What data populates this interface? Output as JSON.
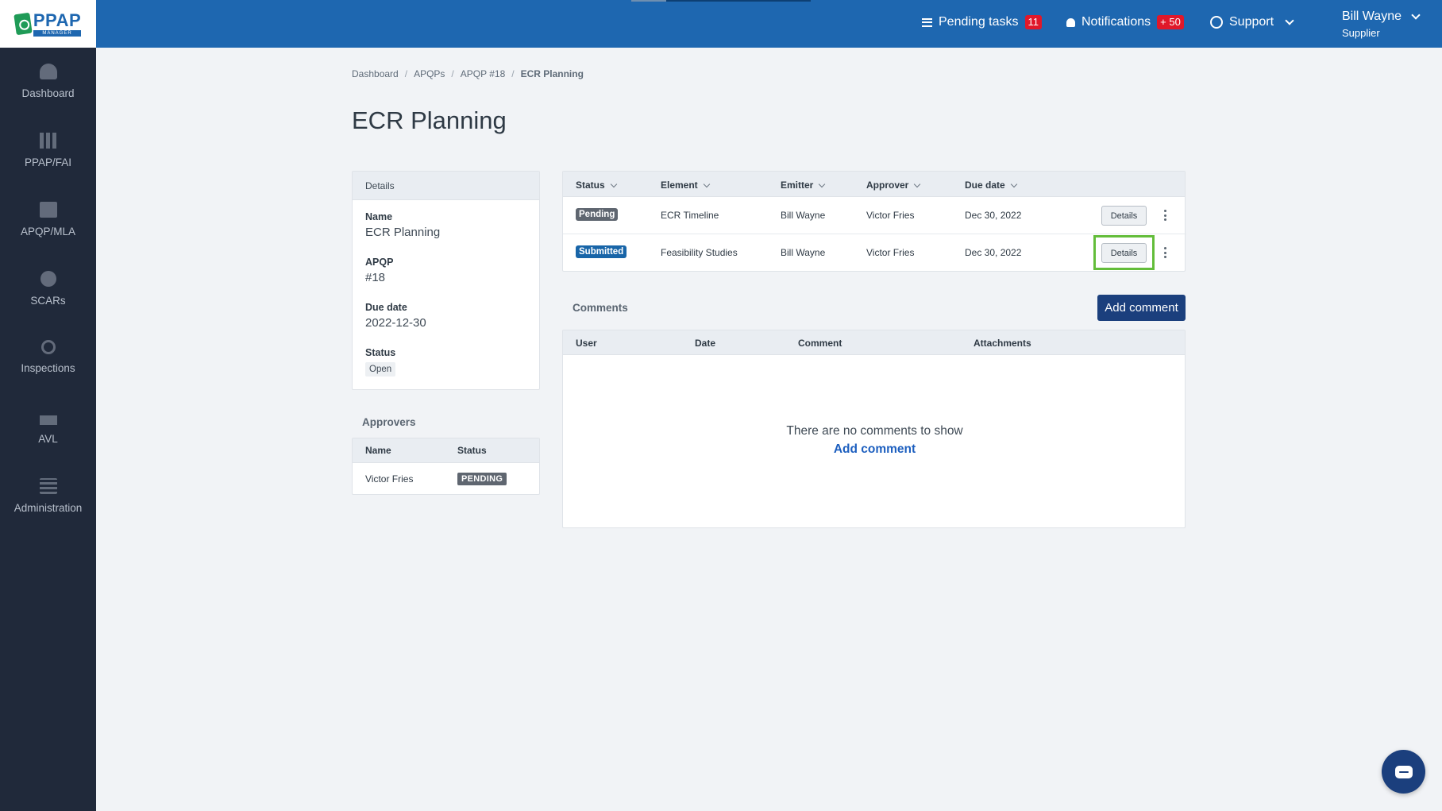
{
  "topbar": {
    "logo_title": "PPAP",
    "logo_sub": "MANAGER",
    "pending_tasks_label": "Pending tasks",
    "pending_tasks_count": "11",
    "notifications_label": "Notifications",
    "notifications_count": "+ 50",
    "support_label": "Support",
    "user_name": "Bill Wayne",
    "user_role": "Supplier",
    "brand_color": "#1e67b0"
  },
  "sidebar": {
    "items": [
      {
        "label": "Dashboard",
        "icon": "gauge-icon"
      },
      {
        "label": "PPAP/FAI",
        "icon": "books-icon"
      },
      {
        "label": "APQP/MLA",
        "icon": "document-icon"
      },
      {
        "label": "SCARs",
        "icon": "badge-8d-icon"
      },
      {
        "label": "Inspections",
        "icon": "inspection-icon"
      },
      {
        "label": "AVL",
        "icon": "factory-icon"
      },
      {
        "label": "Administration",
        "icon": "table-icon"
      }
    ]
  },
  "breadcrumb": [
    "Dashboard",
    "APQPs",
    "APQP #18",
    "ECR Planning"
  ],
  "page_title": "ECR Planning",
  "details": {
    "header": "Details",
    "name_label": "Name",
    "name_value": "ECR Planning",
    "apqp_label": "APQP",
    "apqp_value": "#18",
    "due_label": "Due date",
    "due_value": "2022-12-30",
    "status_label": "Status",
    "status_value": "Open"
  },
  "approvers": {
    "title": "Approvers",
    "columns": [
      "Name",
      "Status"
    ],
    "rows": [
      {
        "name": "Victor Fries",
        "status": "PENDING"
      }
    ]
  },
  "tasks": {
    "columns": [
      "Status",
      "Element",
      "Emitter",
      "Approver",
      "Due date"
    ],
    "rows": [
      {
        "status": "Pending",
        "element": "ECR Timeline",
        "emitter": "Bill Wayne",
        "approver": "Victor Fries",
        "due": "Dec 30, 2022",
        "action": "Details"
      },
      {
        "status": "Submitted",
        "element": "Feasibility Studies",
        "emitter": "Bill Wayne",
        "approver": "Victor Fries",
        "due": "Dec 30, 2022",
        "action": "Details"
      }
    ]
  },
  "comments": {
    "title": "Comments",
    "add_button": "Add comment",
    "columns": [
      "User",
      "Date",
      "Comment",
      "Attachments"
    ],
    "empty_text": "There are no comments to show",
    "empty_link": "Add comment"
  }
}
